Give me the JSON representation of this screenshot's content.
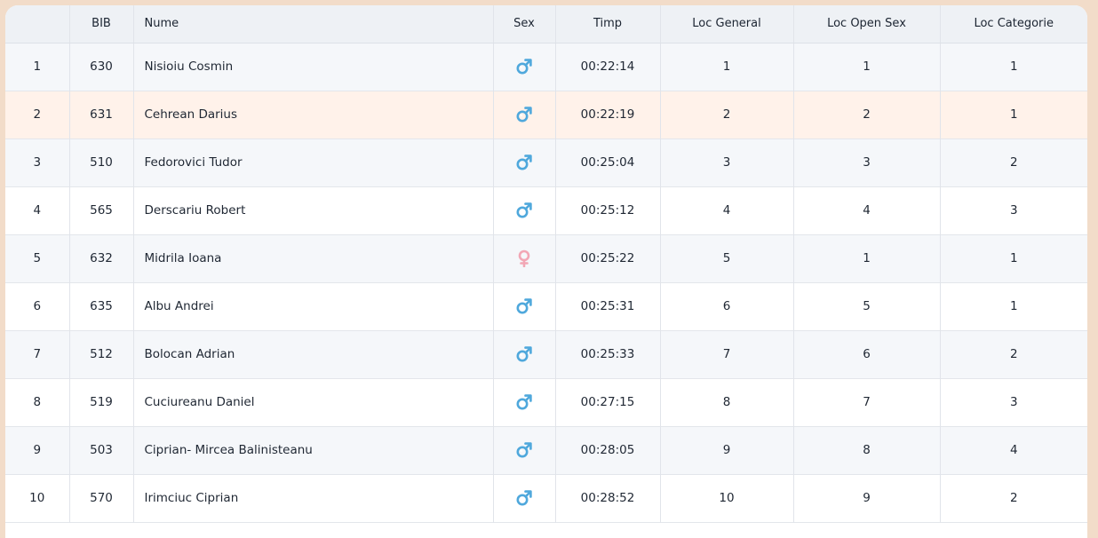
{
  "table": {
    "headers": {
      "rank": "",
      "bib": "BIB",
      "name": "Nume",
      "sex": "Sex",
      "time": "Timp",
      "overall": "Loc General",
      "open_sex": "Loc Open Sex",
      "category": "Loc Categorie"
    },
    "rows": [
      {
        "rank": "1",
        "bib": "630",
        "name": "Nisioiu Cosmin",
        "sex": "male-icon",
        "time": "00:22:14",
        "overall": "1",
        "open_sex": "1",
        "category": "1"
      },
      {
        "rank": "2",
        "bib": "631",
        "name": "Cehrean Darius",
        "sex": "male-icon",
        "time": "00:22:19",
        "overall": "2",
        "open_sex": "2",
        "category": "1"
      },
      {
        "rank": "3",
        "bib": "510",
        "name": "Fedorovici Tudor",
        "sex": "male-icon",
        "time": "00:25:04",
        "overall": "3",
        "open_sex": "3",
        "category": "2"
      },
      {
        "rank": "4",
        "bib": "565",
        "name": "Derscariu Robert",
        "sex": "male-icon",
        "time": "00:25:12",
        "overall": "4",
        "open_sex": "4",
        "category": "3"
      },
      {
        "rank": "5",
        "bib": "632",
        "name": "Midrila Ioana",
        "sex": "female-icon",
        "time": "00:25:22",
        "overall": "5",
        "open_sex": "1",
        "category": "1"
      },
      {
        "rank": "6",
        "bib": "635",
        "name": "Albu Andrei",
        "sex": "male-icon",
        "time": "00:25:31",
        "overall": "6",
        "open_sex": "5",
        "category": "1"
      },
      {
        "rank": "7",
        "bib": "512",
        "name": "Bolocan Adrian",
        "sex": "male-icon",
        "time": "00:25:33",
        "overall": "7",
        "open_sex": "6",
        "category": "2"
      },
      {
        "rank": "8",
        "bib": "519",
        "name": "Cuciureanu Daniel",
        "sex": "male-icon",
        "time": "00:27:15",
        "overall": "8",
        "open_sex": "7",
        "category": "3"
      },
      {
        "rank": "9",
        "bib": "503",
        "name": "Ciprian- Mircea Balinisteanu",
        "sex": "male-icon",
        "time": "00:28:05",
        "overall": "9",
        "open_sex": "8",
        "category": "4"
      },
      {
        "rank": "10",
        "bib": "570",
        "name": "Irimciuc Ciprian",
        "sex": "male-icon",
        "time": "00:28:52",
        "overall": "10",
        "open_sex": "9",
        "category": "2"
      }
    ]
  },
  "colors": {
    "page_background": "#f2dcc9",
    "header_background": "#eef1f5",
    "row_odd": "#f5f7fa",
    "row_even": "#ffffff",
    "row_highlight": "#fff2ea",
    "male_icon": "#4fa8dc",
    "female_icon": "#f2a7b5"
  }
}
